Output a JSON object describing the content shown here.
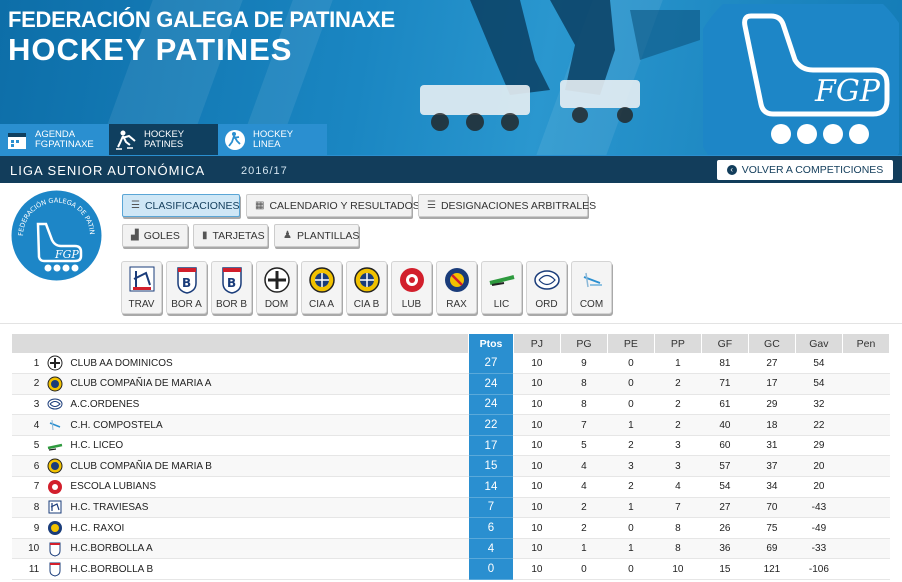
{
  "header": {
    "title_line1": "FEDERACIÓN GALEGA DE PATINAXE",
    "title_line2": "HOCKEY PATINES",
    "logo_text": "FGP"
  },
  "nav_tabs": [
    {
      "label": "AGENDA FGPATINAXE",
      "icon": "calendar-icon"
    },
    {
      "label": "HOCKEY PATINES",
      "icon": "hockey-skater-icon"
    },
    {
      "label": "HOCKEY LINEA",
      "icon": "inline-hockey-icon"
    }
  ],
  "subbar": {
    "league": "LIGA SENIOR AUTONÓMICA",
    "season": "2016/17",
    "back_label": "VOLVER A COMPETICIONES"
  },
  "side_logo": {
    "ring_text": "FEDERACIÓN GALEGA DE PATINAXE",
    "mark": "FGP"
  },
  "menu": {
    "row1": [
      {
        "label": "CLASIFICACIONES",
        "icon": "list-icon",
        "active": true
      },
      {
        "label": "CALENDARIO Y RESULTADOS",
        "icon": "calendar-icon",
        "active": false
      },
      {
        "label": "DESIGNACIONES ARBITRALES",
        "icon": "list-icon",
        "active": false
      }
    ],
    "row2": [
      {
        "label": "GOLES",
        "icon": "chart-icon",
        "active": false
      },
      {
        "label": "TARJETAS",
        "icon": "card-icon",
        "active": false
      },
      {
        "label": "PLANTILLAS",
        "icon": "person-icon",
        "active": false
      }
    ]
  },
  "team_shortcuts": [
    "TRAV",
    "BOR A",
    "BOR B",
    "DOM",
    "CIA A",
    "CIA B",
    "LUB",
    "RAX",
    "LIC",
    "ORD",
    "COM"
  ],
  "colors": {
    "header_blue": "#1a86c2",
    "dark_navy": "#123d5b",
    "points_blue": "#2a8fd0"
  },
  "standings": {
    "columns": [
      "Ptos",
      "PJ",
      "PG",
      "PE",
      "PP",
      "GF",
      "GC",
      "Gav",
      "Pen"
    ],
    "rows": [
      {
        "pos": "1",
        "team": "CLUB AA DOMINICOS",
        "pts": "27",
        "pj": "10",
        "pg": "9",
        "pe": "0",
        "pp": "1",
        "gf": "81",
        "gc": "27",
        "gav": "54",
        "pen": ""
      },
      {
        "pos": "2",
        "team": "CLUB COMPAÑIA DE MARIA A",
        "pts": "24",
        "pj": "10",
        "pg": "8",
        "pe": "0",
        "pp": "2",
        "gf": "71",
        "gc": "17",
        "gav": "54",
        "pen": ""
      },
      {
        "pos": "3",
        "team": "A.C.ORDENES",
        "pts": "24",
        "pj": "10",
        "pg": "8",
        "pe": "0",
        "pp": "2",
        "gf": "61",
        "gc": "29",
        "gav": "32",
        "pen": ""
      },
      {
        "pos": "4",
        "team": "C.H. COMPOSTELA",
        "pts": "22",
        "pj": "10",
        "pg": "7",
        "pe": "1",
        "pp": "2",
        "gf": "40",
        "gc": "18",
        "gav": "22",
        "pen": ""
      },
      {
        "pos": "5",
        "team": "H.C. LICEO",
        "pts": "17",
        "pj": "10",
        "pg": "5",
        "pe": "2",
        "pp": "3",
        "gf": "60",
        "gc": "31",
        "gav": "29",
        "pen": ""
      },
      {
        "pos": "6",
        "team": "CLUB COMPAÑIA DE MARIA B",
        "pts": "15",
        "pj": "10",
        "pg": "4",
        "pe": "3",
        "pp": "3",
        "gf": "57",
        "gc": "37",
        "gav": "20",
        "pen": ""
      },
      {
        "pos": "7",
        "team": "ESCOLA LUBIANS",
        "pts": "14",
        "pj": "10",
        "pg": "4",
        "pe": "2",
        "pp": "4",
        "gf": "54",
        "gc": "34",
        "gav": "20",
        "pen": ""
      },
      {
        "pos": "8",
        "team": "H.C. TRAVIESAS",
        "pts": "7",
        "pj": "10",
        "pg": "2",
        "pe": "1",
        "pp": "7",
        "gf": "27",
        "gc": "70",
        "gav": "-43",
        "pen": ""
      },
      {
        "pos": "9",
        "team": "H.C. RAXOI",
        "pts": "6",
        "pj": "10",
        "pg": "2",
        "pe": "0",
        "pp": "8",
        "gf": "26",
        "gc": "75",
        "gav": "-49",
        "pen": ""
      },
      {
        "pos": "10",
        "team": "H.C.BORBOLLA A",
        "pts": "4",
        "pj": "10",
        "pg": "1",
        "pe": "1",
        "pp": "8",
        "gf": "36",
        "gc": "69",
        "gav": "-33",
        "pen": ""
      },
      {
        "pos": "11",
        "team": "H.C.BORBOLLA B",
        "pts": "0",
        "pj": "10",
        "pg": "0",
        "pe": "0",
        "pp": "10",
        "gf": "15",
        "gc": "121",
        "gav": "-106",
        "pen": ""
      }
    ]
  }
}
